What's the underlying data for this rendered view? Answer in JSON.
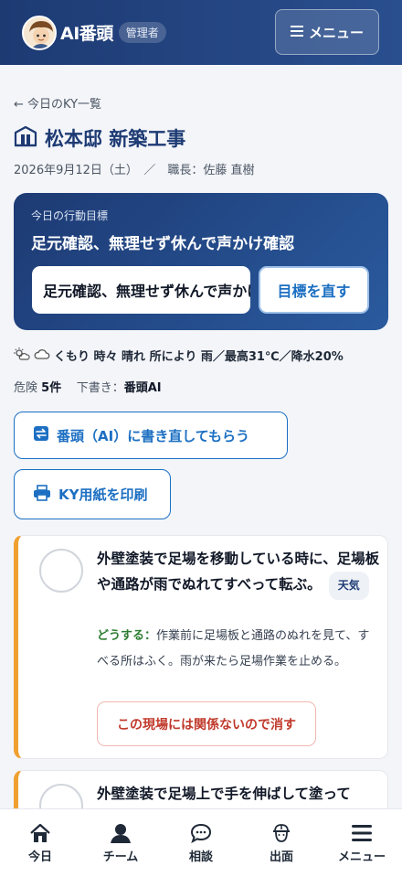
{
  "header": {
    "app_name": "AI番頭",
    "role_badge": "管理者",
    "menu_label": "メニュー"
  },
  "back_link": "← 今日のKY一覧",
  "site": {
    "title": "松本邸 新築工事",
    "meta": "2026年9月12日（土）　／　職長：佐藤 直樹"
  },
  "goal": {
    "caption": "今日の行動目標",
    "text": "足元確認、無理せず休んで声かけ確認",
    "input_value": "足元確認、無理せず休んで声かけ確認",
    "edit_button": "目標を直す"
  },
  "weather": {
    "text": "くもり 時々 晴れ 所により 雨／最高31℃／降水20%"
  },
  "stats": {
    "hazard_label": "危険",
    "hazard_count": "5件",
    "draft_label": "下書き：",
    "draft_value": "番頭AI"
  },
  "actions": {
    "ai_rewrite": "番頭（AI）に書き直してもらう",
    "print": "KY用紙を印刷"
  },
  "hazards": [
    {
      "text": "外壁塗装で足場を移動している時に、足場板や通路が雨でぬれてすべって転ぶ。",
      "tag": "天気",
      "how_label": "どうする：",
      "how_text": "作業前に足場板と通路のぬれを見て、すべる所はふく。雨が来たら足場作業を止める。",
      "remove_button": "この現場には関係ないので消す"
    },
    {
      "text": "外壁塗装で足場上で手を伸ばして塗って"
    }
  ],
  "nav": [
    {
      "label": "今日",
      "icon": "home-icon"
    },
    {
      "label": "チーム",
      "icon": "team-icon"
    },
    {
      "label": "相談",
      "icon": "chat-icon"
    },
    {
      "label": "出面",
      "icon": "worker-icon"
    },
    {
      "label": "メニュー",
      "icon": "menu-icon"
    }
  ],
  "colors": {
    "header": "#1d3a73",
    "accent": "#1c6fc2",
    "warning_border": "#f0a030",
    "danger": "#c0392b",
    "how_label": "#2e7d32"
  }
}
